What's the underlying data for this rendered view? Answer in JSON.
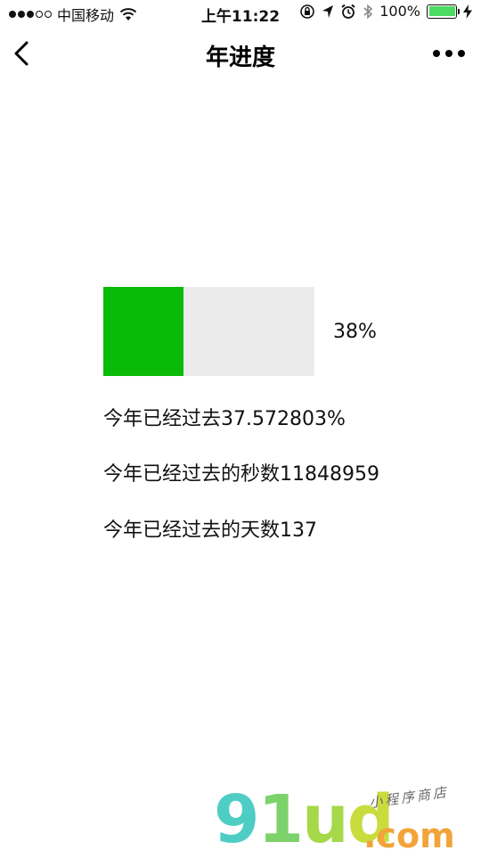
{
  "status_bar": {
    "carrier": "中国移动",
    "time": "上午11:22",
    "battery_percent": "100%",
    "icons": [
      "signal-dots",
      "wifi-icon",
      "orientation-lock-icon",
      "location-arrow-icon",
      "alarm-icon",
      "bluetooth-icon",
      "battery-icon",
      "charging-bolt-icon"
    ]
  },
  "nav": {
    "title": "年进度",
    "back_icon": "chevron-left-icon",
    "more_icon": "more-dots-icon"
  },
  "progress": {
    "value_fraction": 0.38,
    "label": "38%",
    "fill_color": "#09bb07",
    "track_color": "#ebebeb"
  },
  "info": {
    "percent_line": "今年已经过去37.572803%",
    "seconds_line": "今年已经过去的秒数11848959",
    "days_line": "今年已经过去的天数137"
  },
  "watermark": {
    "logo_text": "91ud",
    "domain_text": ".com",
    "tagline": "小程序商店"
  }
}
